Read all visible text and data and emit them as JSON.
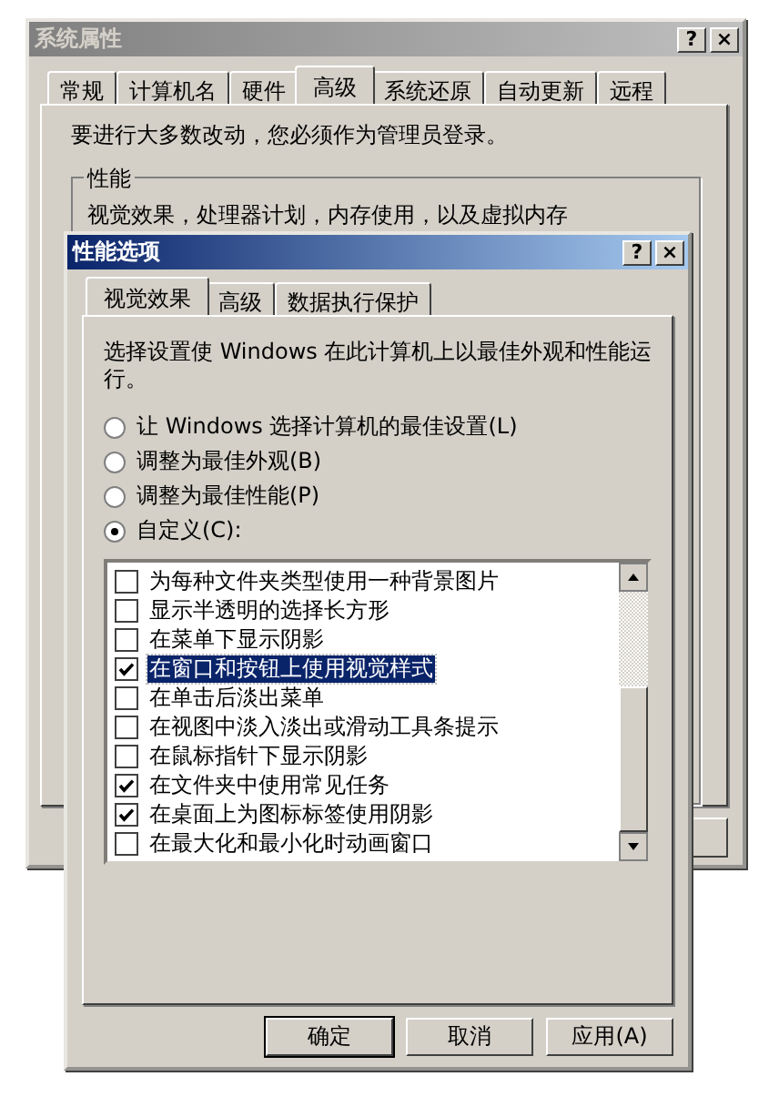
{
  "back_window": {
    "title": "系统属性",
    "title_buttons": [
      "?",
      "×"
    ],
    "tabs": [
      {
        "label": "常规",
        "selected": false
      },
      {
        "label": "计算机名",
        "selected": false
      },
      {
        "label": "硬件",
        "selected": false
      },
      {
        "label": "高级",
        "selected": true
      },
      {
        "label": "系统还原",
        "selected": false
      },
      {
        "label": "自动更新",
        "selected": false
      },
      {
        "label": "远程",
        "selected": false
      }
    ],
    "admin_note": "要进行大多数改动，您必须作为管理员登录。",
    "performance_group": {
      "label": "性能",
      "description": "视觉效果，处理器计划，内存使用，以及虚拟内存"
    }
  },
  "dialog": {
    "title": "性能选项",
    "title_buttons": [
      "?",
      "×"
    ],
    "tabs": [
      {
        "label": "视觉效果",
        "selected": true
      },
      {
        "label": "高级",
        "selected": false
      },
      {
        "label": "数据执行保护",
        "selected": false
      }
    ],
    "intro": "选择设置使 Windows 在此计算机上以最佳外观和性能运行。",
    "options": [
      {
        "label": "让 Windows 选择计算机的最佳设置(L)",
        "selected": false
      },
      {
        "label": "调整为最佳外观(B)",
        "selected": false
      },
      {
        "label": "调整为最佳性能(P)",
        "selected": false
      },
      {
        "label": "自定义(C):",
        "selected": true
      }
    ],
    "effects": [
      {
        "label": "为每种文件夹类型使用一种背景图片",
        "checked": false,
        "selected": false
      },
      {
        "label": "显示半透明的选择长方形",
        "checked": false,
        "selected": false
      },
      {
        "label": "在菜单下显示阴影",
        "checked": false,
        "selected": false
      },
      {
        "label": "在窗口和按钮上使用视觉样式",
        "checked": true,
        "selected": true
      },
      {
        "label": "在单击后淡出菜单",
        "checked": false,
        "selected": false
      },
      {
        "label": "在视图中淡入淡出或滑动工具条提示",
        "checked": false,
        "selected": false
      },
      {
        "label": "在鼠标指针下显示阴影",
        "checked": false,
        "selected": false
      },
      {
        "label": "在文件夹中使用常见任务",
        "checked": true,
        "selected": false
      },
      {
        "label": "在桌面上为图标标签使用阴影",
        "checked": true,
        "selected": false
      },
      {
        "label": "在最大化和最小化时动画窗口",
        "checked": false,
        "selected": false
      }
    ],
    "buttons": [
      {
        "label": "确定",
        "default": true
      },
      {
        "label": "取消",
        "default": false
      },
      {
        "label": "应用(A)",
        "default": false
      }
    ]
  }
}
